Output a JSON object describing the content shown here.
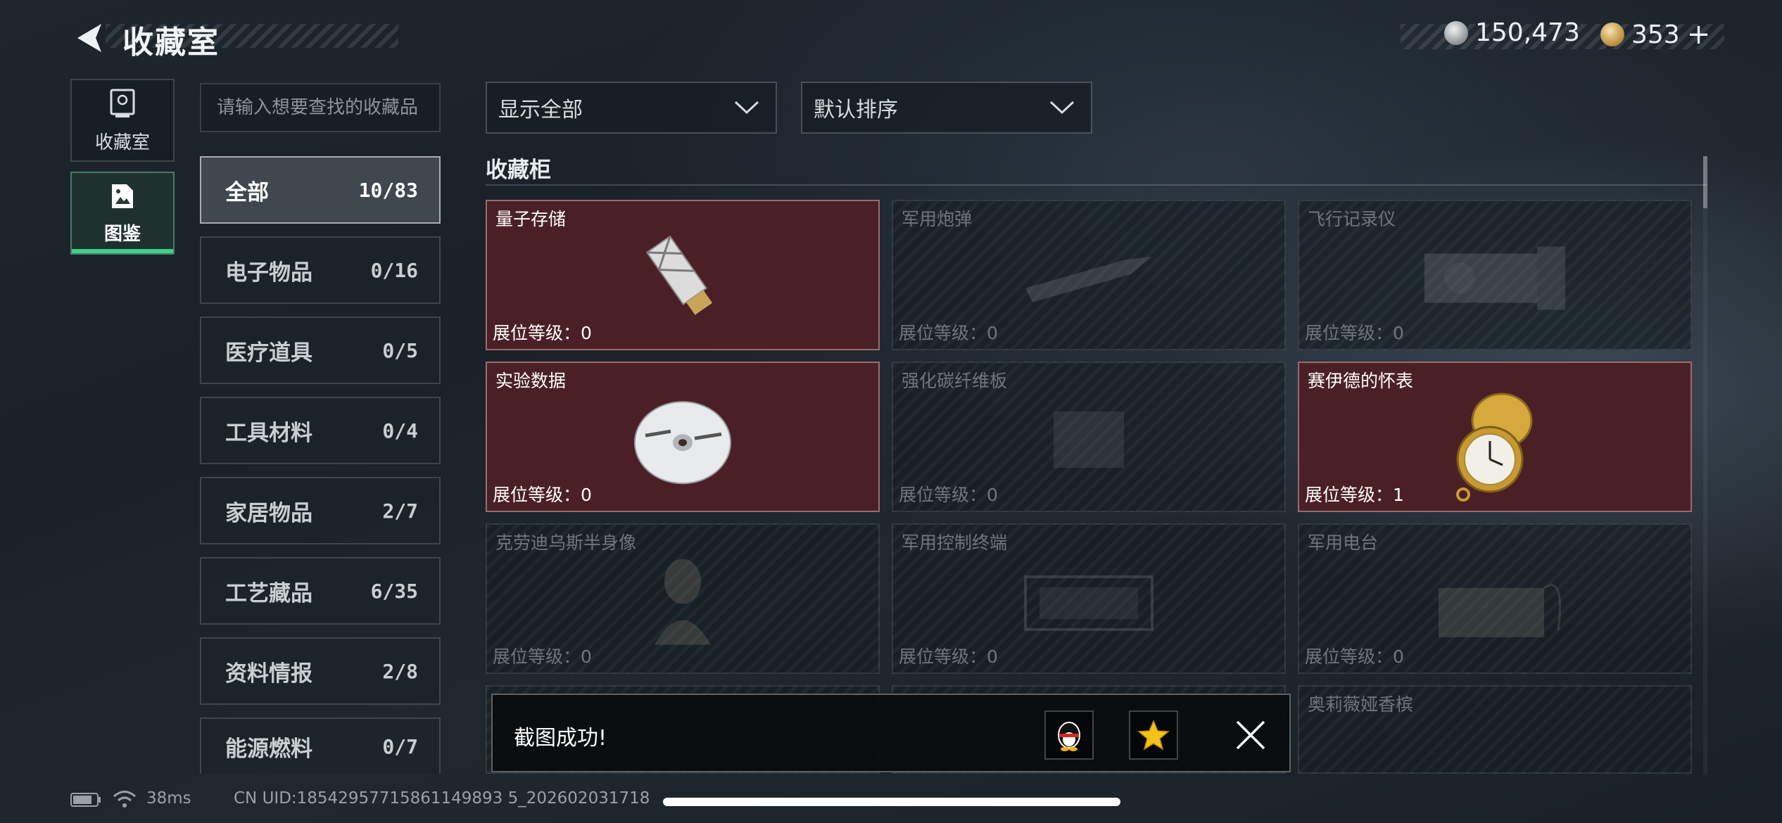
{
  "header": {
    "title": "收藏室",
    "currency": [
      {
        "icon": "silver-coin-icon",
        "value": "150,473"
      },
      {
        "icon": "gold-coin-icon",
        "value": "353"
      }
    ],
    "add_label": "+"
  },
  "rail": [
    {
      "label": "收藏室",
      "icon": "cabinet-icon",
      "active": false
    },
    {
      "label": "图鉴",
      "icon": "catalog-icon",
      "active": true
    }
  ],
  "search": {
    "placeholder": "请输入想要查找的收藏品"
  },
  "categories": [
    {
      "name": "全部",
      "count": "10/83",
      "active": true
    },
    {
      "name": "电子物品",
      "count": "0/16"
    },
    {
      "name": "医疗道具",
      "count": "0/5"
    },
    {
      "name": "工具材料",
      "count": "0/4"
    },
    {
      "name": "家居物品",
      "count": "2/7"
    },
    {
      "name": "工艺藏品",
      "count": "6/35"
    },
    {
      "name": "资料情报",
      "count": "2/8"
    },
    {
      "name": "能源燃料",
      "count": "0/7"
    }
  ],
  "filters": {
    "display": "显示全部",
    "sort": "默认排序"
  },
  "section_title": "收藏柜",
  "cards": [
    {
      "name": "量子存储",
      "level": "展位等级：0",
      "owned": true
    },
    {
      "name": "军用炮弹",
      "level": "展位等级：0",
      "owned": false
    },
    {
      "name": "飞行记录仪",
      "level": "展位等级：0",
      "owned": false
    },
    {
      "name": "实验数据",
      "level": "展位等级：0",
      "owned": true
    },
    {
      "name": "强化碳纤维板",
      "level": "展位等级：0",
      "owned": false
    },
    {
      "name": "赛伊德的怀表",
      "level": "展位等级：1",
      "owned": true
    },
    {
      "name": "克劳迪乌斯半身像",
      "level": "展位等级：0",
      "owned": false
    },
    {
      "name": "军用控制终端",
      "level": "展位等级：0",
      "owned": false
    },
    {
      "name": "军用电台",
      "level": "展位等级：0",
      "owned": false
    },
    {
      "name": "",
      "level": "",
      "owned": false
    },
    {
      "name": "",
      "level": "",
      "owned": false
    },
    {
      "name": "奥莉薇娅香槟",
      "level": "",
      "owned": false
    }
  ],
  "toast": {
    "message": "截图成功!"
  },
  "status": {
    "ping": "38ms",
    "uid": "CN UID:18542957715861149893 5_202602031718"
  }
}
